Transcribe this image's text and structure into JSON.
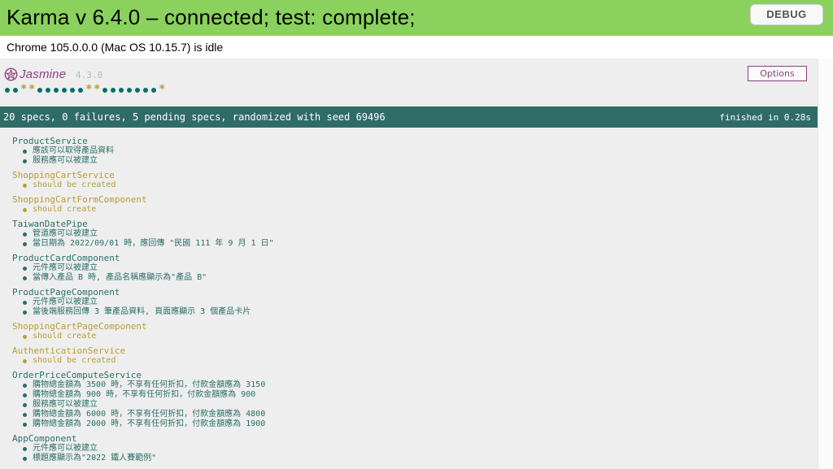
{
  "karma": {
    "title": "Karma v 6.4.0 – connected; test: complete;",
    "debug_label": "DEBUG",
    "browser_status": "Chrome 105.0.0.0 (Mac OS 10.15.7) is idle"
  },
  "jasmine": {
    "logo_text": "Jasmine",
    "version": "4.3.0",
    "options_label": "Options",
    "symbols": [
      "passed",
      "passed",
      "pending",
      "pending",
      "passed",
      "passed",
      "passed",
      "passed",
      "passed",
      "passed",
      "pending",
      "pending",
      "passed",
      "passed",
      "passed",
      "passed",
      "passed",
      "passed",
      "passed",
      "pending"
    ],
    "summary": "20 specs, 0 failures, 5 pending specs, randomized with seed 69496",
    "duration": "finished in 0.28s",
    "colors": {
      "passed": "#007069",
      "pending": "#ba9d37",
      "bar": "#2f6b67",
      "brand": "#8a4182",
      "karma_banner": "#8bd15e"
    }
  },
  "suites": [
    {
      "name": "ProductService",
      "status": "passed",
      "specs": [
        {
          "text": "應該可以取得產品資料",
          "status": "passed"
        },
        {
          "text": "服務應可以被建立",
          "status": "passed"
        }
      ]
    },
    {
      "name": "ShoppingCartService",
      "status": "pending",
      "specs": [
        {
          "text": "should be created",
          "status": "pending"
        }
      ]
    },
    {
      "name": "ShoppingCartFormComponent",
      "status": "pending",
      "specs": [
        {
          "text": "should create",
          "status": "pending"
        }
      ]
    },
    {
      "name": "TaiwanDatePipe",
      "status": "passed",
      "specs": [
        {
          "text": "管道應可以被建立",
          "status": "passed"
        },
        {
          "text": "當日期為 2022/09/01 時，應回傳 \"民國 111 年 9 月 1 日\"",
          "status": "passed"
        }
      ]
    },
    {
      "name": "ProductCardComponent",
      "status": "passed",
      "specs": [
        {
          "text": "元件應可以被建立",
          "status": "passed"
        },
        {
          "text": "當傳入產品 B 時, 產品名稱應顯示為\"產品 B\"",
          "status": "passed"
        }
      ]
    },
    {
      "name": "ProductPageComponent",
      "status": "passed",
      "specs": [
        {
          "text": "元件應可以被建立",
          "status": "passed"
        },
        {
          "text": "當後端服務回傳 3 筆產品資料, 頁面應顯示 3 個產品卡片",
          "status": "passed"
        }
      ]
    },
    {
      "name": "ShoppingCartPageComponent",
      "status": "pending",
      "specs": [
        {
          "text": "should create",
          "status": "pending"
        }
      ]
    },
    {
      "name": "AuthenticationService",
      "status": "pending",
      "specs": [
        {
          "text": "should be created",
          "status": "pending"
        }
      ]
    },
    {
      "name": "OrderPriceComputeService",
      "status": "passed",
      "specs": [
        {
          "text": "購物總金額為 3500 時，不享有任何折扣，付款金額應為 3150",
          "status": "passed"
        },
        {
          "text": "購物總金額為 900 時，不享有任何折扣，付款金額應為 900",
          "status": "passed"
        },
        {
          "text": "服務應可以被建立",
          "status": "passed"
        },
        {
          "text": "購物總金額為 6000 時，不享有任何折扣，付款金額應為 4800",
          "status": "passed"
        },
        {
          "text": "購物總金額為 2000 時，不享有任何折扣，付款金額應為 1900",
          "status": "passed"
        }
      ]
    },
    {
      "name": "AppComponent",
      "status": "passed",
      "specs": [
        {
          "text": "元件應可以被建立",
          "status": "passed"
        },
        {
          "text": "標題應顯示為\"2022 鐵人賽範例\"",
          "status": "passed"
        }
      ]
    }
  ]
}
